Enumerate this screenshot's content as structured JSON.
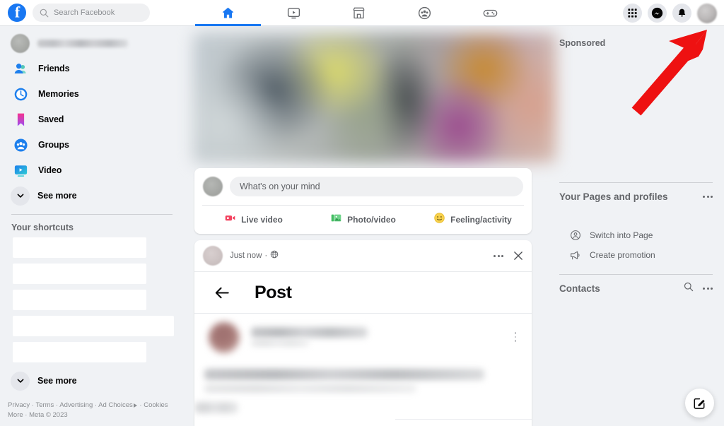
{
  "topbar": {
    "logo_alt": "Facebook",
    "search": {
      "placeholder": "Search Facebook",
      "value": ""
    },
    "nav_tabs": [
      {
        "name": "home",
        "label": "Home",
        "active": true
      },
      {
        "name": "video",
        "label": "Video",
        "active": false
      },
      {
        "name": "marketplace",
        "label": "Marketplace",
        "active": false
      },
      {
        "name": "groups",
        "label": "Groups",
        "active": false
      },
      {
        "name": "gaming",
        "label": "Gaming",
        "active": false
      }
    ],
    "right_actions": [
      {
        "name": "menu-grid",
        "label": "Menu"
      },
      {
        "name": "messenger",
        "label": "Messenger"
      },
      {
        "name": "notifications",
        "label": "Notifications"
      },
      {
        "name": "account-avatar",
        "label": "Account"
      }
    ]
  },
  "sidebar": {
    "profile_name": "",
    "items": [
      {
        "label": "Friends",
        "icon": "friends-icon"
      },
      {
        "label": "Memories",
        "icon": "memories-clock-icon"
      },
      {
        "label": "Saved",
        "icon": "saved-bookmark-icon"
      },
      {
        "label": "Groups",
        "icon": "groups-icon"
      },
      {
        "label": "Video",
        "icon": "video-icon"
      }
    ],
    "see_more_top": "See more",
    "shortcuts_title": "Your shortcuts",
    "shortcuts": [
      "",
      "",
      "",
      "",
      ""
    ],
    "see_more_bottom": "See more",
    "footer": {
      "line1": [
        "Privacy",
        "Terms",
        "Advertising",
        "Ad Choices",
        "Cookies"
      ],
      "line2": [
        "More",
        "Meta © 2023"
      ]
    }
  },
  "feed": {
    "composer": {
      "placeholder": "What's on your mind",
      "actions": [
        {
          "label": "Live video",
          "icon": "live-video-icon",
          "color": "#f3425f"
        },
        {
          "label": "Photo/video",
          "icon": "photo-video-icon",
          "color": "#45bd62"
        },
        {
          "label": "Feeling/activity",
          "icon": "feeling-activity-icon",
          "color": "#f7b928"
        }
      ]
    },
    "post": {
      "timestamp": "Just now",
      "audience": "Public",
      "audience_icon": "globe-icon",
      "menu_icon": "more-options-icon",
      "close_icon": "close-icon",
      "back_icon": "back-arrow-icon",
      "title": "Post"
    }
  },
  "right_sidebar": {
    "sponsored_label": "Sponsored",
    "pages_section": {
      "title": "Your Pages and profiles",
      "menu_icon": "more-options-icon",
      "items": [
        {
          "label": "Switch into Page",
          "icon": "switch-page-icon"
        },
        {
          "label": "Create promotion",
          "icon": "megaphone-icon"
        }
      ]
    },
    "contacts_section": {
      "title": "Contacts",
      "search_icon": "search-icon",
      "menu_icon": "more-options-icon"
    }
  },
  "floating": {
    "compose_label": "New message",
    "compose_icon": "compose-pencil-icon"
  },
  "annotation": {
    "arrow_color": "#ee1111",
    "points_to": "account-avatar"
  },
  "colors": {
    "brand_blue": "#1877f2",
    "page_bg": "#f0f2f5",
    "card_bg": "#ffffff",
    "text_primary": "#050505",
    "text_secondary": "#65676b",
    "annotation_red": "#ee1111"
  }
}
